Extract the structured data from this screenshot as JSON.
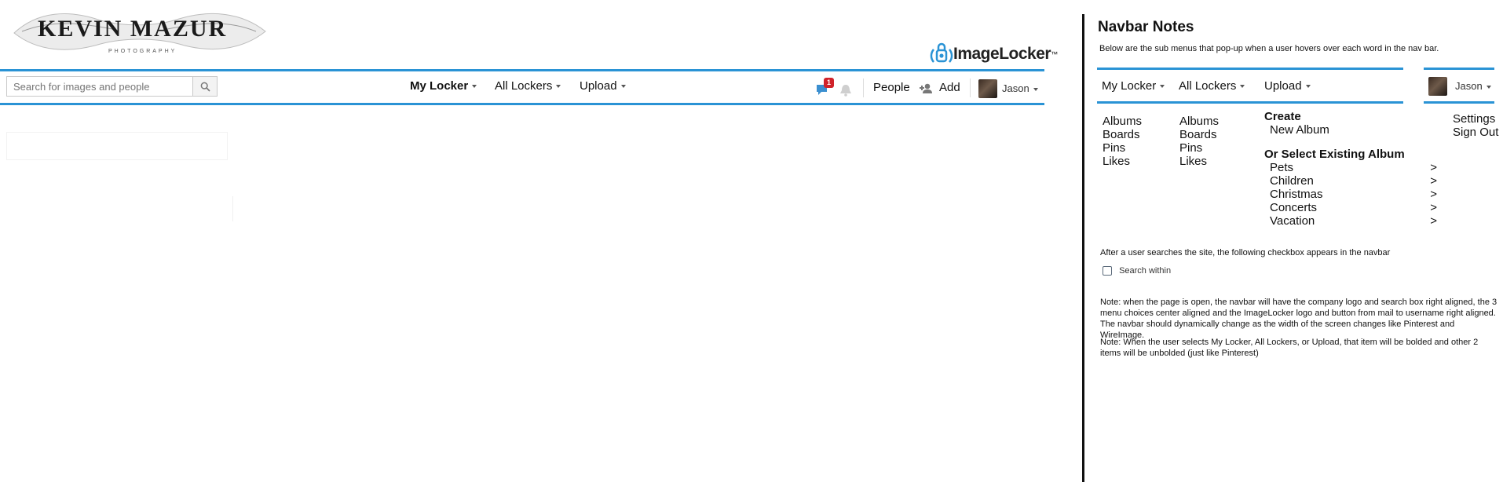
{
  "site": {
    "logo_name": "KEVIN MAZUR",
    "logo_sub": "PHOTOGRAPHY",
    "imagelocker_logo": "ImageLocker",
    "imagelocker_tm": "™"
  },
  "navbar": {
    "search_placeholder": "Search for images and people",
    "menu": [
      {
        "label": "My Locker"
      },
      {
        "label": "All Lockers"
      },
      {
        "label": "Upload"
      }
    ],
    "notification_count": "1",
    "people_label": "People",
    "add_label": "Add",
    "user_name": "Jason"
  },
  "notes": {
    "title": "Navbar Notes",
    "subtitle": "Below are the sub menus that pop-up when a user hovers over each word in the nav bar.",
    "mini_menu": [
      {
        "label": "My Locker"
      },
      {
        "label": "All Lockers"
      },
      {
        "label": "Upload"
      }
    ],
    "mini_user": "Jason",
    "my_locker_sub": [
      "Albums",
      "Boards",
      "Pins",
      "Likes"
    ],
    "all_lockers_sub": [
      "Albums",
      "Boards",
      "Pins",
      "Likes"
    ],
    "upload": {
      "create_heading": "Create",
      "new_album": "New Album",
      "select_heading": "Or Select Existing Album",
      "albums": [
        "Pets",
        "Children",
        "Christmas",
        "Concerts",
        "Vacation"
      ],
      "arrow": ">"
    },
    "user_sub": [
      "Settings",
      "Sign Out"
    ],
    "search_note": "After a user searches the site, the following checkbox appears in the navbar",
    "search_within": "Search within",
    "note1": "Note: when the page is open, the navbar will have the company logo and search box right aligned, the 3 menu choices center aligned and the ImageLocker logo and button from mail to username right aligned. The navbar should dynamically change as the width of the screen changes like Pinterest and WireImage.",
    "note2": "Note: When the user selects My Locker, All Lockers, or Upload, that item will be bolded and other 2 items will be unbolded (just like Pinterest)"
  },
  "colors": {
    "accent_blue": "#2a93d5",
    "badge_red": "#d0222a"
  }
}
